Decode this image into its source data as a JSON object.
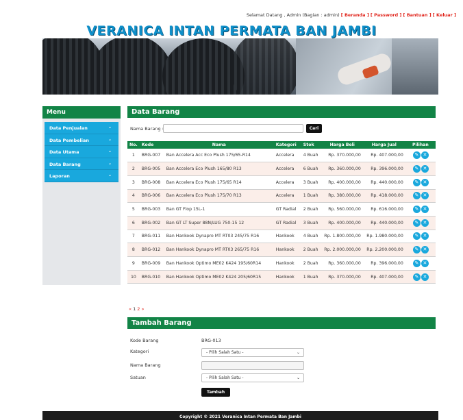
{
  "topbar": {
    "greeting": "Selamat Datang , Admin (Bagian : admin)",
    "links": [
      "[ Beranda ]",
      "[ Password ]",
      "[ Bantuan ]",
      "[ Keluar ]"
    ]
  },
  "site_title": "VERANICA INTAN PERMATA BAN JAMBI",
  "sidebar": {
    "title": "Menu",
    "items": [
      {
        "label": "Data Penjualan"
      },
      {
        "label": "Data Pembelian"
      },
      {
        "label": "Data Utama"
      },
      {
        "label": "Data Barang"
      },
      {
        "label": "Laporan"
      }
    ]
  },
  "main": {
    "title": "Data Barang",
    "search": {
      "label": "Nama Barang :",
      "value": "",
      "button": "Cari"
    },
    "table": {
      "headers": [
        "No.",
        "Kode",
        "Nama",
        "Kategori",
        "Stok",
        "Harga Beli",
        "Harga Jual",
        "Pilihan"
      ],
      "rows": [
        [
          "1",
          "BRG-007",
          "Ban Accelera Acc Eco Plush 175/65-R14",
          "Accelera",
          "4 Buah",
          "Rp. 370.000,00",
          "Rp. 407.000,00"
        ],
        [
          "2",
          "BRG-005",
          "Ban Accelera Eco Plush 165/80 R13",
          "Accelera",
          "6 Buah",
          "Rp. 360.000,00",
          "Rp. 396.000,00"
        ],
        [
          "3",
          "BRG-008",
          "Ban Accelera Eco Plush 175/65 R14",
          "Accelera",
          "3 Buah",
          "Rp. 400.000,00",
          "Rp. 440.000,00"
        ],
        [
          "4",
          "BRG-006",
          "Ban Accelera Eco Plush 175/70 R13",
          "Accelera",
          "1 Buah",
          "Rp. 380.000,00",
          "Rp. 418.000,00"
        ],
        [
          "5",
          "BRG-003",
          "Ban GT Flop 15L-1",
          "GT Radial",
          "2 Buah",
          "Rp. 560.000,00",
          "Rp. 616.000,00"
        ],
        [
          "6",
          "BRG-002",
          "Ban GT LT Super 88N/LUG 750-15 12",
          "GT Radial",
          "3 Buah",
          "Rp. 400.000,00",
          "Rp. 440.000,00"
        ],
        [
          "7",
          "BRG-011",
          "Ban Hankook Dynapro MT RT03 245/75 R16",
          "Hankook",
          "4 Buah",
          "Rp. 1.800.000,00",
          "Rp. 1.980.000,00"
        ],
        [
          "8",
          "BRG-012",
          "Ban Hankook Dynapro MT RT03 265/75 R16",
          "Hankook",
          "2 Buah",
          "Rp. 2.000.000,00",
          "Rp. 2.200.000,00"
        ],
        [
          "9",
          "BRG-009",
          "Ban Hankook Optimo ME02 K424 195/60R14",
          "Hankook",
          "2 Buah",
          "Rp. 360.000,00",
          "Rp. 396.000,00"
        ],
        [
          "10",
          "BRG-010",
          "Ban Hankook Optimo ME02 K424 205/60R15",
          "Hankook",
          "1 Buah",
          "Rp. 370.000,00",
          "Rp. 407.000,00"
        ]
      ]
    },
    "pager": {
      "prev": "«",
      "p1": "1",
      "p2": "2",
      "next": "»"
    }
  },
  "form": {
    "title": "Tambah Barang",
    "kode_label": "Kode Barang",
    "kode_value": "BRG-013",
    "kategori_label": "Kategori",
    "kategori_selected": "- Pilih Salah Satu -",
    "nama_label": "Nama Barang",
    "nama_value": "",
    "satuan_label": "Satuan",
    "satuan_selected": "- Pilih Salah Satu -",
    "submit": "Tambah"
  },
  "footer": "Copyright © 2021 Veranica Intan Permata Ban Jambi",
  "icons": {
    "edit": "pencil-icon",
    "delete": "trash-icon",
    "chevron": "chevron-down-icon"
  },
  "colors": {
    "green": "#128446",
    "blue": "#19a8dd",
    "red": "#e0231a"
  }
}
